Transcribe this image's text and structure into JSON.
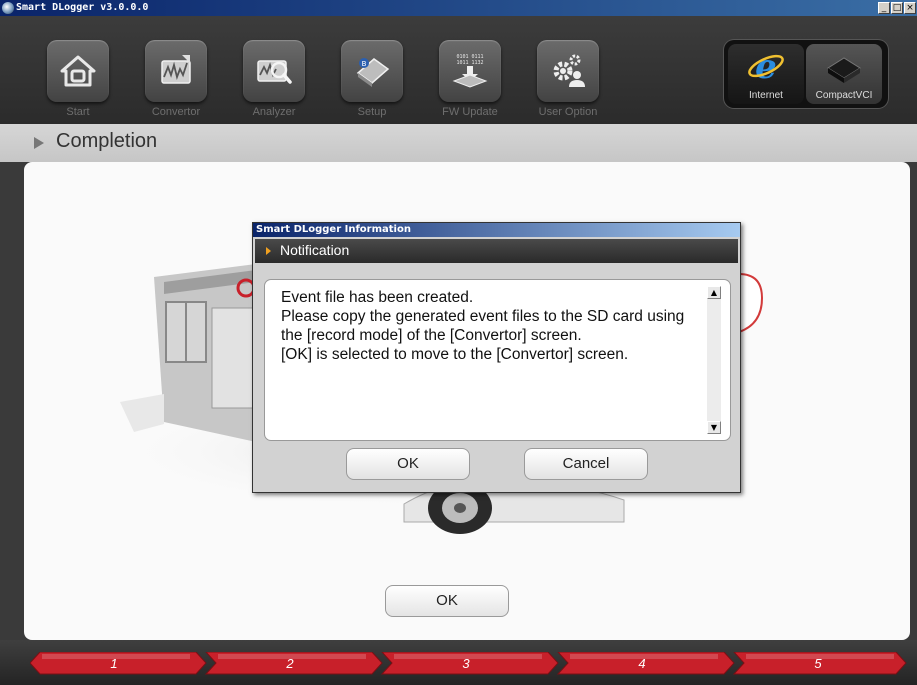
{
  "window": {
    "title": "Smart DLogger v3.0.0.0",
    "controls": [
      "_",
      "□",
      "×"
    ]
  },
  "toolbar": {
    "items": [
      {
        "label": "Start",
        "icon": "home-icon"
      },
      {
        "label": "Convertor",
        "icon": "convertor-icon"
      },
      {
        "label": "Analyzer",
        "icon": "analyzer-icon"
      },
      {
        "label": "Setup",
        "icon": "setup-icon"
      },
      {
        "label": "FW Update",
        "icon": "fw-update-icon",
        "icon_text": [
          "0101 0111",
          "1011 1132"
        ]
      },
      {
        "label": "User Option",
        "icon": "user-option-icon"
      }
    ],
    "external": [
      {
        "label": "Internet",
        "icon": "internet-explorer-icon"
      },
      {
        "label": "CompactVCI",
        "icon": "compact-vci-icon"
      }
    ]
  },
  "page": {
    "heading": "Completion",
    "ok_label": "OK"
  },
  "dialog": {
    "window_title": "Smart DLogger Information",
    "header": "Notification",
    "message": "Event file has been created.\nPlease copy the generated event files to the SD card using the [record mode] of the [Convertor] screen.\n[OK] is selected to move to the [Convertor] screen.",
    "ok_label": "OK",
    "cancel_label": "Cancel"
  },
  "steps": [
    "1",
    "2",
    "3",
    "4",
    "5"
  ],
  "colors": {
    "step_red": "#c8202a",
    "notification_arrow": "#f0a020",
    "titlebar_blue": "#0a246a"
  }
}
